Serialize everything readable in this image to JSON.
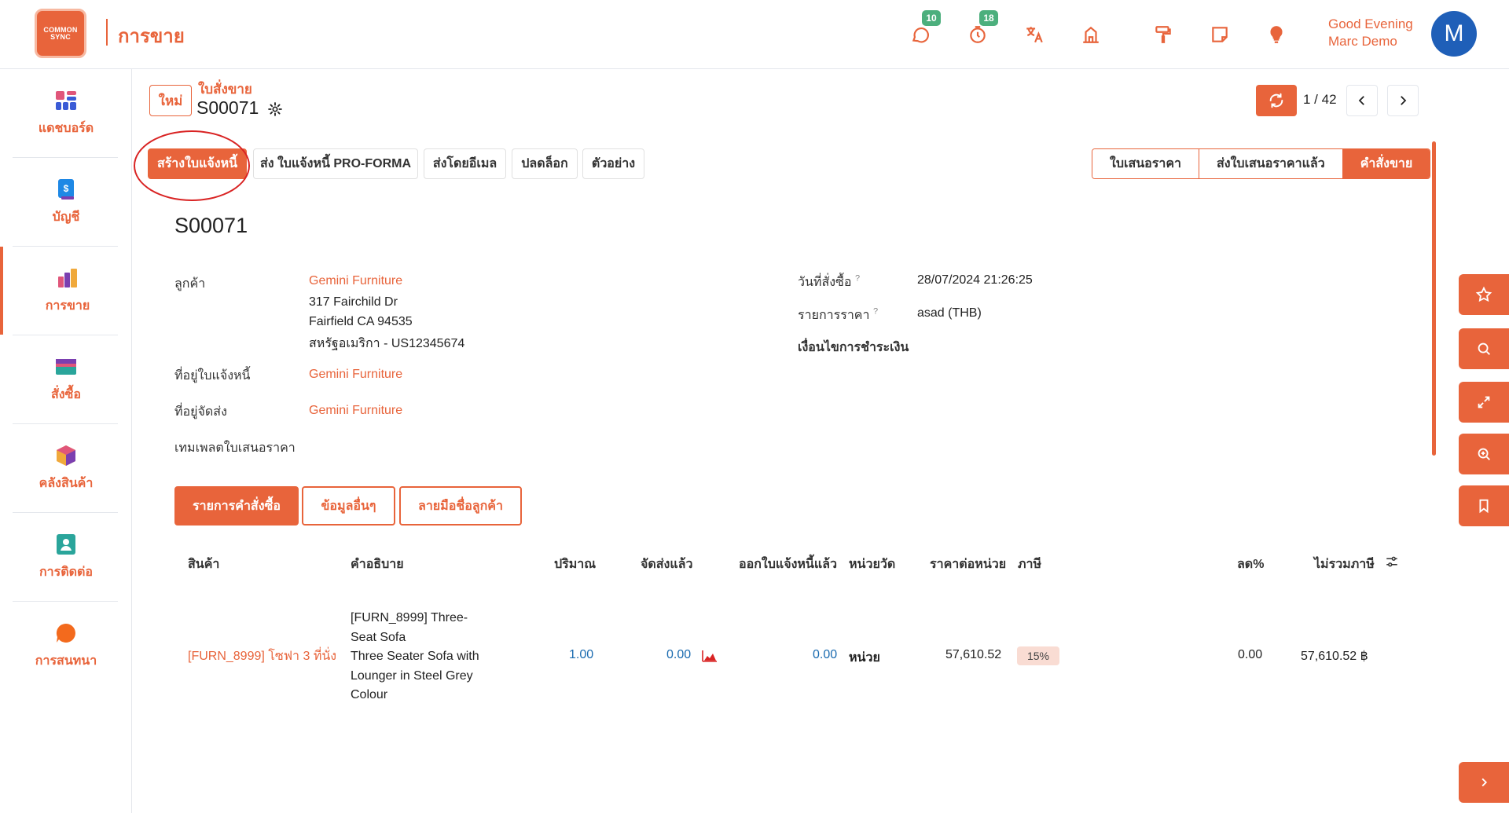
{
  "app": {
    "logo_text": "COMMON SYNC",
    "title": "การขาย"
  },
  "topbar": {
    "icons": [
      {
        "name": "chat-icon",
        "badge": "10"
      },
      {
        "name": "timer-icon",
        "badge": "18"
      },
      {
        "name": "translate-icon"
      },
      {
        "name": "building-icon"
      },
      {
        "name": "paint-roller-icon"
      },
      {
        "name": "note-icon"
      },
      {
        "name": "lightbulb-icon"
      }
    ],
    "greeting_line1": "Good Evening",
    "greeting_line2": "Marc Demo",
    "avatar_letter": "M"
  },
  "sidebar": {
    "items": [
      {
        "label": "แดชบอร์ด"
      },
      {
        "label": "บัญชี"
      },
      {
        "label": "การขาย",
        "active": true
      },
      {
        "label": "สั่งซื้อ"
      },
      {
        "label": "คลังสินค้า"
      },
      {
        "label": "การติดต่อ"
      },
      {
        "label": "การสนทนา"
      }
    ]
  },
  "header": {
    "new_button": "ใหม่",
    "breadcrumb_parent": "ใบสั่งขาย",
    "breadcrumb_current": "S00071",
    "pager": "1 / 42"
  },
  "actions": {
    "create_invoice": "สร้างใบแจ้งหนี้",
    "send_proforma": "ส่ง ใบแจ้งหนี้ PRO-FORMA",
    "send_email": "ส่งโดยอีเมล",
    "unlock": "ปลดล็อก",
    "preview": "ตัวอย่าง"
  },
  "status": {
    "steps": [
      "ใบเสนอราคา",
      "ส่งใบเสนอราคาแล้ว",
      "คำสั่งขาย"
    ],
    "current_index": 2
  },
  "form": {
    "doc_number": "S00071",
    "customer_label": "ลูกค้า",
    "customer_name": "Gemini Furniture",
    "address_line1": "317 Fairchild Dr",
    "address_line2": "Fairfield CA 94535",
    "address_line3": "สหรัฐอเมริกา - US12345674",
    "invoice_address_label": "ที่อยู่ใบแจ้งหนี้",
    "invoice_address": "Gemini Furniture",
    "delivery_address_label": "ที่อยู่จัดส่ง",
    "delivery_address": "Gemini Furniture",
    "quote_template_label": "เทมเพลตใบเสนอราคา",
    "order_date_label": "วันที่สั่งซื้อ",
    "order_date": "28/07/2024 21:26:25",
    "pricelist_label": "รายการราคา",
    "pricelist": "asad (THB)",
    "payment_terms_label": "เงื่อนไขการชำระเงิน",
    "help_mark": "?"
  },
  "tabs": {
    "order_lines": "รายการคำสั่งซื้อ",
    "other_info": "ข้อมูลอื่นๆ",
    "customer_signature": "ลายมือชื่อลูกค้า"
  },
  "table": {
    "headers": {
      "product": "สินค้า",
      "description": "คำอธิบาย",
      "quantity": "ปริมาณ",
      "delivered": "จัดส่งแล้ว",
      "invoiced": "ออกใบแจ้งหนี้แล้ว",
      "uom": "หน่วยวัด",
      "unit_price": "ราคาต่อหน่วย",
      "tax": "ภาษี",
      "discount": "ลด%",
      "subtotal": "ไม่รวมภาษี"
    },
    "rows": [
      {
        "product": "[FURN_8999] โซฟา 3 ที่นั่ง",
        "desc1": "[FURN_8999] Three-",
        "desc2": "Seat Sofa",
        "desc3": "Three Seater Sofa with",
        "desc4": "Lounger in Steel Grey",
        "desc5": "Colour",
        "quantity": "1.00",
        "delivered": "0.00",
        "invoiced": "0.00",
        "uom": "หน่วย",
        "unit_price": "57,610.52",
        "tax": "15%",
        "discount": "0.00",
        "subtotal": "57,610.52 ฿"
      }
    ]
  },
  "colors": {
    "accent": "#e8643b",
    "badge": "#4caf7d",
    "avatar": "#1f5fb8",
    "link_blue": "#1a6bb0",
    "highlight": "#d92323"
  }
}
